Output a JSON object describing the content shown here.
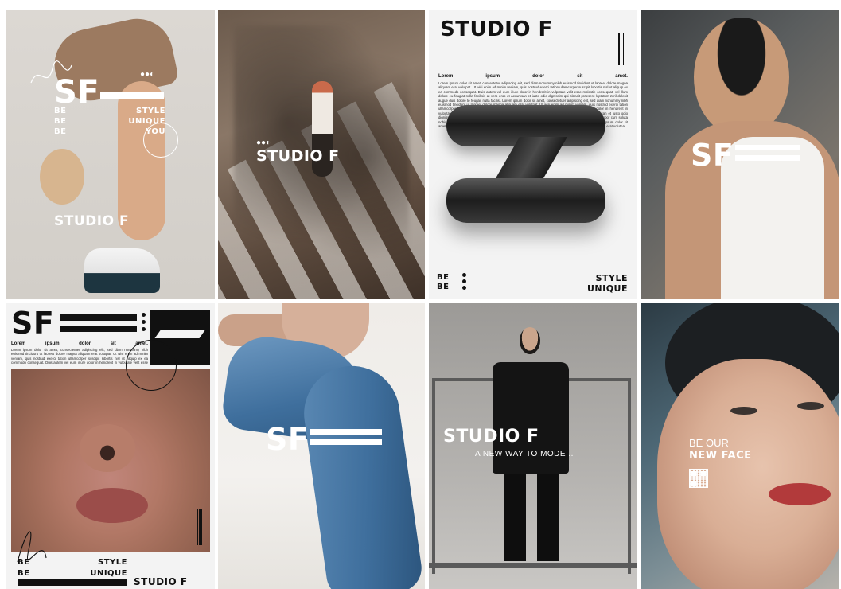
{
  "colors": {
    "white": "#ffffff",
    "black": "#111111",
    "neutral_bg": "#d9d6d1",
    "denim": "#3f6f9d",
    "lipstick": "#b23a3b"
  },
  "icons": [
    "signature-scribble",
    "circle-outline",
    "dots-icon",
    "barcode-icon",
    "qr-code-icon",
    "3d-logo-mark"
  ],
  "posters": {
    "p1": {
      "logo": "SF",
      "dots": "●●◐",
      "be1": "BE",
      "be2": "BE",
      "be3": "BE",
      "w1": "STYLE",
      "w2": "UNIQUE",
      "w3": "YOU",
      "brand": "STUDIO F"
    },
    "p2": {
      "dots": "●●◐",
      "brand": "STUDIO F"
    },
    "p3": {
      "title": "STUDIO F",
      "heading": [
        "Lorem",
        "ipsum",
        "dolor",
        "sit",
        "amet."
      ],
      "body": "Lorem ipsum dolor sit amet, consectetur adipiscing elit, sed diam nonummy nibh euismod tincidunt ut laoreet dolore magna aliquam erat volutpat. Ut wisi enim ad minim veniam, quis nostrud exerci tation ullamcorper suscipit lobortis nisl ut aliquip ex ea commodo consequat. Duis autem vel eum iriure dolor in hendrerit in vulputate velit esse molestie consequat, vel illum dolore eu feugiat nulla facilisis at vero eros et accumsan et iusto odio dignissim qui blandit praesent luptatum zzril delenit augue duis dolore te feugait nulla facilisi. Lorem ipsum dolor sit amet, consectetuer adipiscing elit, sed diam nonummy nibh euismod tincidunt ut laoreet dolore magna aliquam erat volutpat. Ut wisi enim ad minim veniam, quis nostrud exerci tation ullamcorper suscipit lobortis nisl ut aliquip ex ea commodo consequat. Duis autem vel eum iriure dolor in hendrerit in vulputate velit esse molestie consequat, vel illum dolore eu feugiat nulla facilisis at vero eros et accumsan et iusto odio dignissim qui blandit praesent luptatum zzril delenit augue duis dolore te feugait nulla facilisi. Nam liber tempor cum soluta nobis eleifend option congue nihil imperdiet doming id quod mazim placerat facer possim assum. Lorem ipsum dolor sit amet, consectetuer adipiscing elit, sed diam nonummy nibh euismod tincidunt ut laoreet dolore magna aliquam erat volutpat.",
      "be1": "BE",
      "be2": "BE",
      "w1": "STYLE",
      "w2": "UNIQUE"
    },
    "p4": {
      "logo": "SF"
    },
    "p5": {
      "logo": "SF",
      "heading": [
        "Lorem",
        "ipsum",
        "dolor",
        "sit",
        "amet."
      ],
      "body": "Lorem ipsum dolor sit amet, consectetuer adipiscing elit, sed diam nonummy nibh euismod tincidunt ut laoreet dolore magna aliquam erat volutpat. Ut wisi enim ad minim veniam, quis nostrud exerci tation ullamcorper suscipit lobortis nisl ut aliquip ex ea commodo consequat. Duis autem vel eum iriure dolor in hendrerit in vulputate velit esse molestie consequat, vel illum dolore eu feugiat nulla facilisis at vero eros et accumsan et iusto odio.",
      "be1": "BE",
      "be2": "BE",
      "w1": "STYLE",
      "w2": "UNIQUE",
      "brand": "STUDIO F"
    },
    "p6": {
      "logo": "SF"
    },
    "p7": {
      "brand": "STUDIO F",
      "tagline": "A NEW WAY TO MODE..."
    },
    "p8": {
      "line1": "BE OUR",
      "line2": "NEW FACE"
    }
  }
}
